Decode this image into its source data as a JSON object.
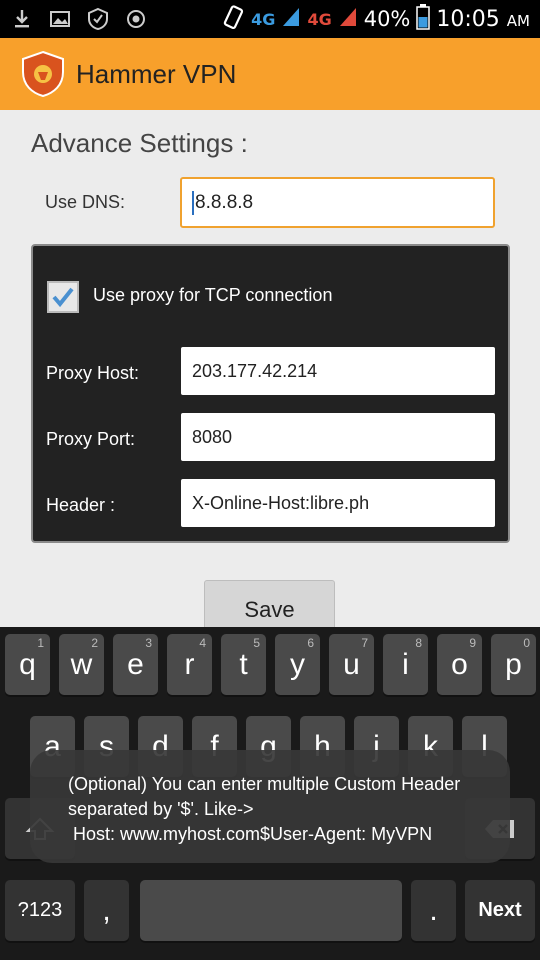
{
  "status_bar": {
    "network_4g_1": "4G",
    "network_4g_2": "4G",
    "battery_percent": "40%",
    "time": "10:05",
    "ampm": "AM"
  },
  "app": {
    "title": "Hammer VPN",
    "accent_color": "#f8a02b"
  },
  "settings": {
    "section_title": "Advance Settings :",
    "dns_label": "Use DNS:",
    "dns_value": "8.8.8.8",
    "proxy_checkbox_label": "Use proxy for TCP connection",
    "proxy_checked": true,
    "proxy_host_label": "Proxy Host:",
    "proxy_host_value": "203.177.42.214",
    "proxy_port_label": "Proxy Port:",
    "proxy_port_value": "8080",
    "header_label": "Header :",
    "header_value": "X-Online-Host:libre.ph",
    "save_label": "Save"
  },
  "keyboard": {
    "row1": [
      {
        "key": "q",
        "hint": "1"
      },
      {
        "key": "w",
        "hint": "2"
      },
      {
        "key": "e",
        "hint": "3"
      },
      {
        "key": "r",
        "hint": "4"
      },
      {
        "key": "t",
        "hint": "5"
      },
      {
        "key": "y",
        "hint": "6"
      },
      {
        "key": "u",
        "hint": "7"
      },
      {
        "key": "i",
        "hint": "8"
      },
      {
        "key": "o",
        "hint": "9"
      },
      {
        "key": "p",
        "hint": "0"
      }
    ],
    "row2": [
      "a",
      "s",
      "d",
      "f",
      "g",
      "h",
      "j",
      "k",
      "l"
    ],
    "symbols_key": "?123",
    "comma_key": ",",
    "period_key": ".",
    "next_key": "Next"
  },
  "toast": {
    "line1": "(Optional) You can enter multiple Custom Header",
    "line2": "separated by '$'. Like->",
    "line3": "Host: www.myhost.com$User-Agent: MyVPN"
  }
}
